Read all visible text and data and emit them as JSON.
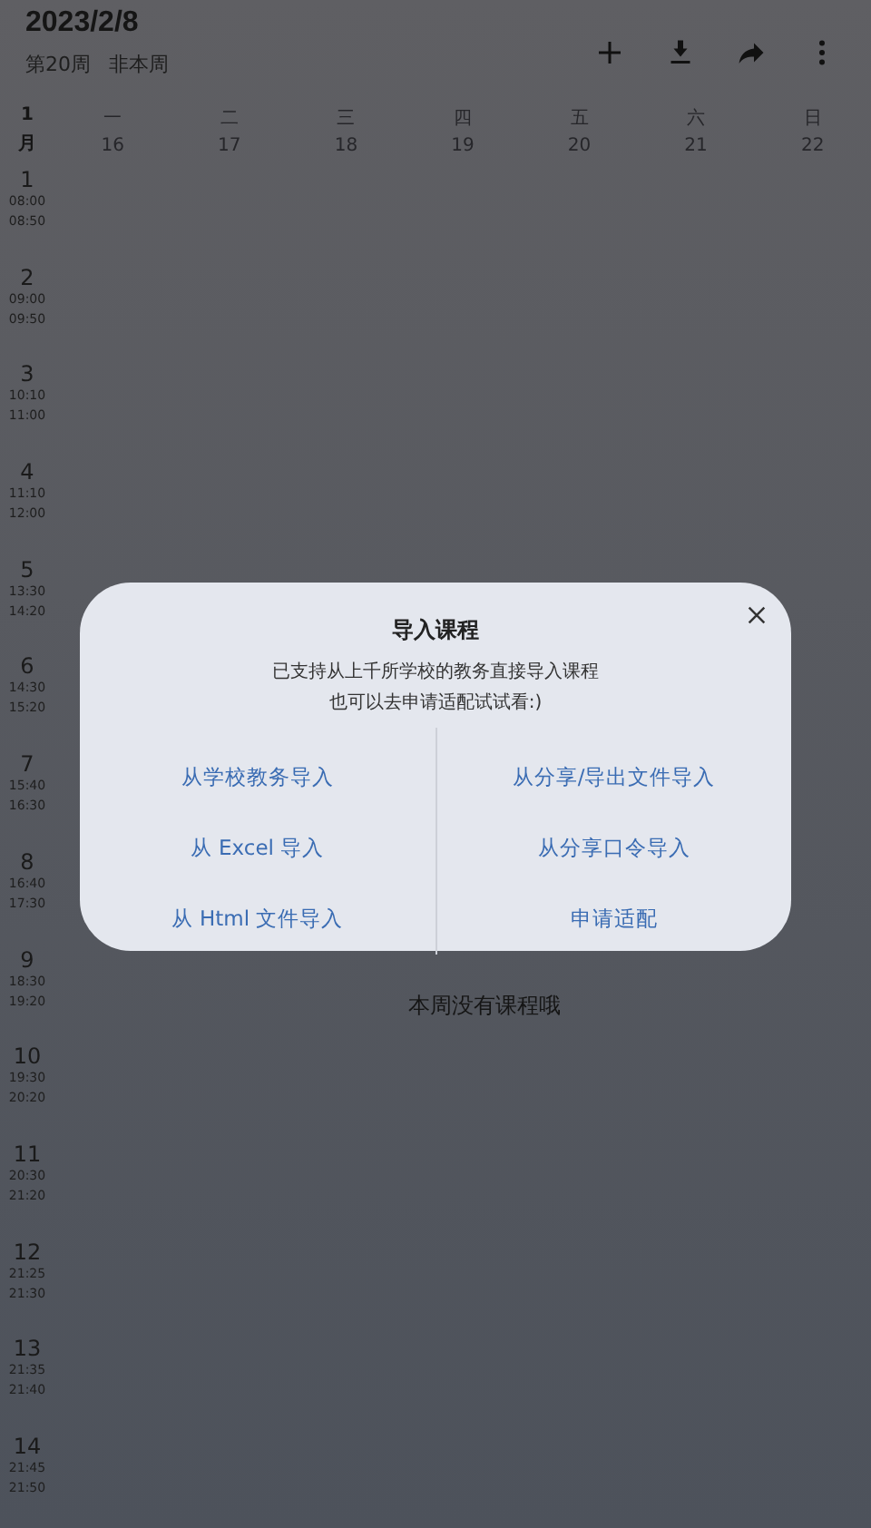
{
  "header": {
    "date": "2023/2/8",
    "week": "第20周",
    "week_status": "非本周"
  },
  "month": {
    "number": "1",
    "unit": "月"
  },
  "days": [
    {
      "weekday": "一",
      "date": "16"
    },
    {
      "weekday": "二",
      "date": "17"
    },
    {
      "weekday": "三",
      "date": "18"
    },
    {
      "weekday": "四",
      "date": "19"
    },
    {
      "weekday": "五",
      "date": "20"
    },
    {
      "weekday": "六",
      "date": "21"
    },
    {
      "weekday": "日",
      "date": "22"
    }
  ],
  "periods": [
    {
      "number": "1",
      "start": "08:00",
      "end": "08:50"
    },
    {
      "number": "2",
      "start": "09:00",
      "end": "09:50"
    },
    {
      "number": "3",
      "start": "10:10",
      "end": "11:00"
    },
    {
      "number": "4",
      "start": "11:10",
      "end": "12:00"
    },
    {
      "number": "5",
      "start": "13:30",
      "end": "14:20"
    },
    {
      "number": "6",
      "start": "14:30",
      "end": "15:20"
    },
    {
      "number": "7",
      "start": "15:40",
      "end": "16:30"
    },
    {
      "number": "8",
      "start": "16:40",
      "end": "17:30"
    },
    {
      "number": "9",
      "start": "18:30",
      "end": "19:20"
    },
    {
      "number": "10",
      "start": "19:30",
      "end": "20:20"
    },
    {
      "number": "11",
      "start": "20:30",
      "end": "21:20"
    },
    {
      "number": "12",
      "start": "21:25",
      "end": "21:30"
    },
    {
      "number": "13",
      "start": "21:35",
      "end": "21:40"
    },
    {
      "number": "14",
      "start": "21:45",
      "end": "21:50"
    }
  ],
  "empty_message": "本周没有课程哦",
  "dialog": {
    "title": "导入课程",
    "lines": [
      "已支持从上千所学校的教务直接导入课程",
      "也可以去申请适配试试看:)"
    ],
    "options_left": [
      "从学校教务导入",
      "从 Excel 导入",
      "从 Html 文件导入"
    ],
    "options_right": [
      "从分享/导出文件导入",
      "从分享口令导入",
      "申请适配"
    ]
  }
}
